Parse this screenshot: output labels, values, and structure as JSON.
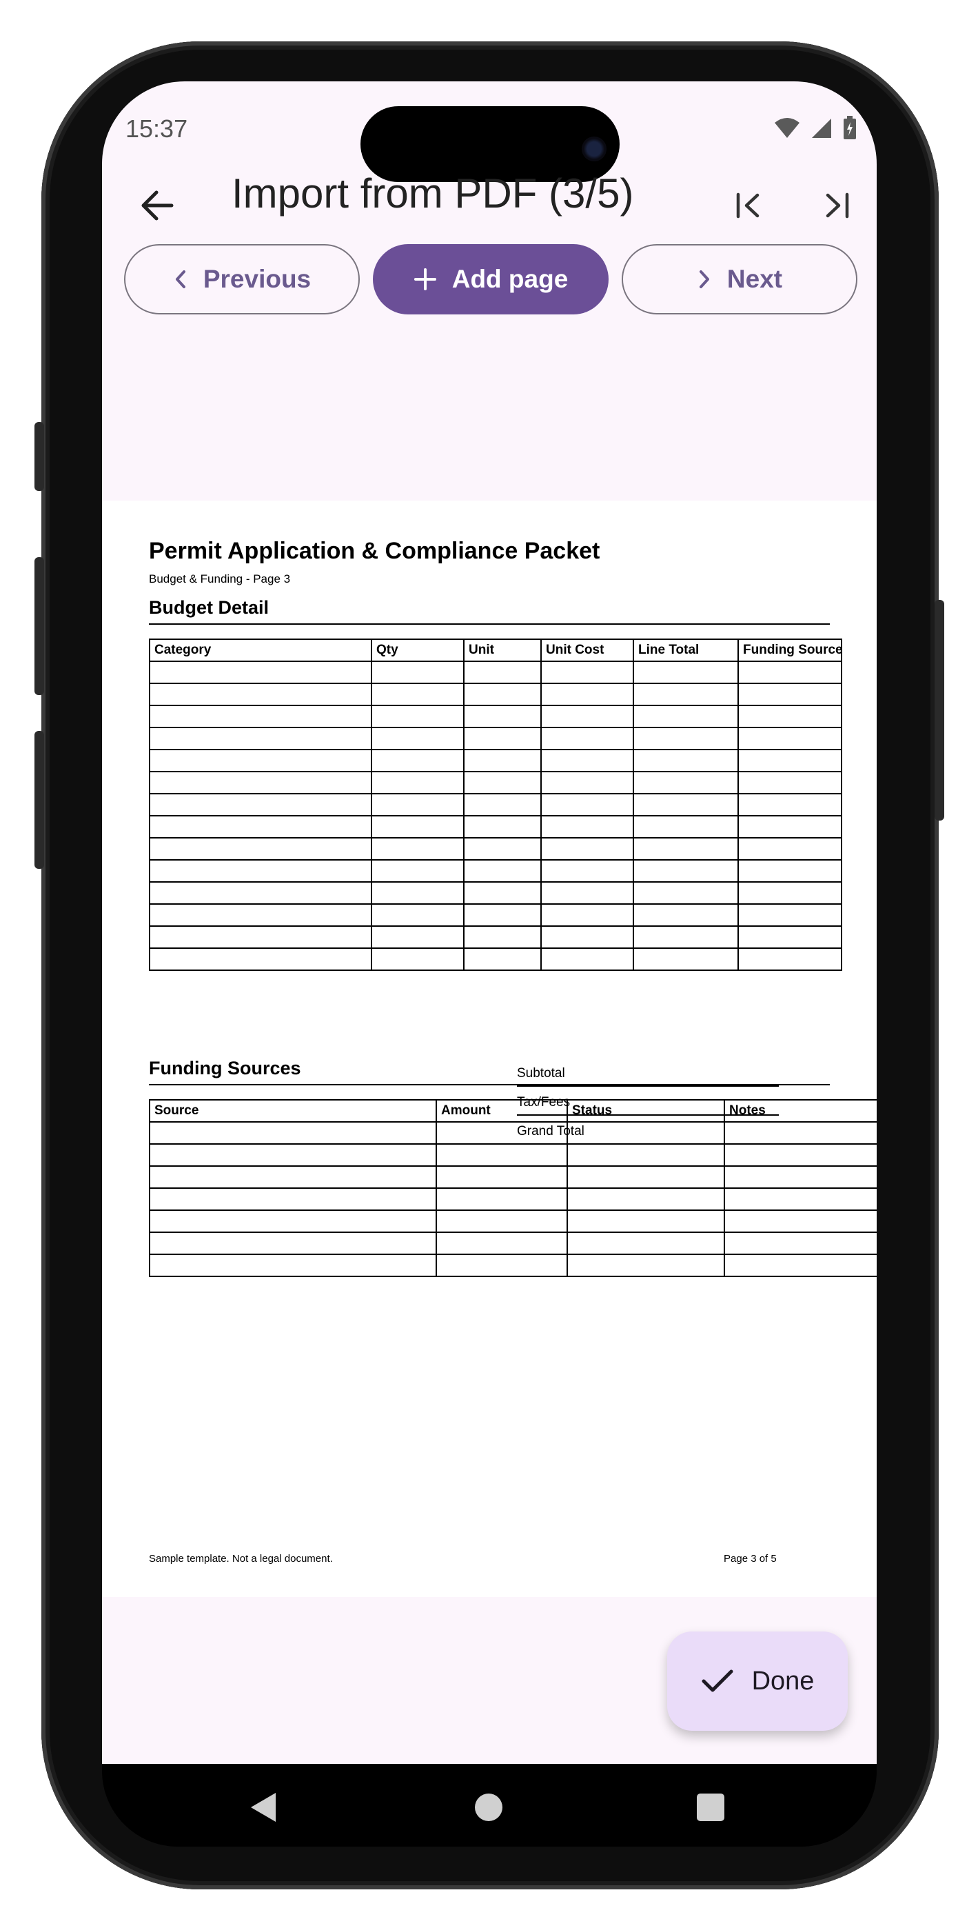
{
  "status_bar": {
    "time": "15:37"
  },
  "app_bar": {
    "title": "Import from PDF (3/5)",
    "back_icon": "arrow-back-icon",
    "first_icon": "first-page-icon",
    "last_icon": "last-page-icon"
  },
  "actions": {
    "previous": "Previous",
    "add_page": "Add page",
    "next": "Next"
  },
  "document": {
    "title": "Permit Application & Compliance Packet",
    "subtitle": "Budget & Funding - Page 3",
    "budget_section": "Budget Detail",
    "budget_columns": [
      "Category",
      "Qty",
      "Unit",
      "Unit Cost",
      "Line Total",
      "Funding Source"
    ],
    "budget_row_count": 14,
    "totals": [
      "Subtotal",
      "Tax/Fees",
      "Grand Total"
    ],
    "funding_section": "Funding Sources",
    "funding_columns": [
      "Source",
      "Amount",
      "Status",
      "Notes"
    ],
    "funding_row_count": 7,
    "footer_left": "Sample template. Not a legal document.",
    "footer_right": "Page 3 of 5"
  },
  "fab": {
    "label": "Done",
    "icon": "check-icon"
  },
  "colors": {
    "accent": "#6b4f97",
    "surface": "#fcf5fc",
    "fab": "#eadcf9"
  }
}
